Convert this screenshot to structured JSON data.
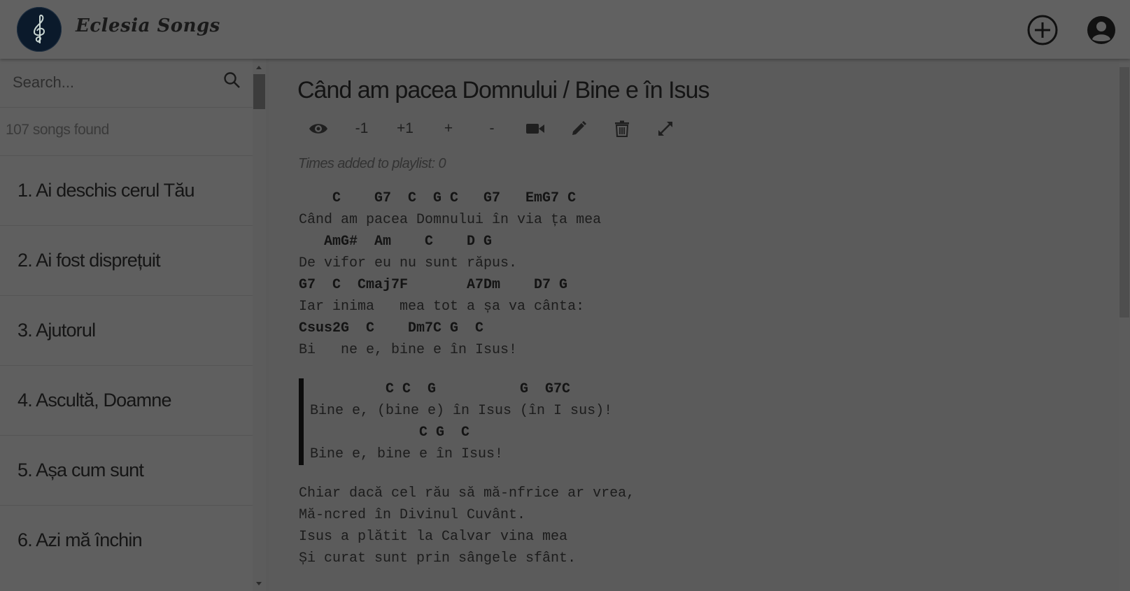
{
  "header": {
    "brand": "Eclesia Songs",
    "logo_icon": "treble-clef-icon",
    "add_icon": "plus-circle-icon",
    "user_icon": "user-account-icon"
  },
  "sidebar": {
    "search_placeholder": "Search...",
    "songs_found": "107 songs found",
    "songs": [
      {
        "label": "1. Ai deschis cerul Tău"
      },
      {
        "label": "2. Ai fost disprețuit"
      },
      {
        "label": "3. Ajutorul"
      },
      {
        "label": "4. Ascultă, Doamne"
      },
      {
        "label": "5. Așa cum sunt"
      },
      {
        "label": "6. Azi mă închin"
      }
    ]
  },
  "main": {
    "title": "Când am pacea Domnului / Bine e în Isus",
    "toolbar": {
      "transpose_down": "-1",
      "transpose_up": "+1",
      "font_increase": "+",
      "font_decrease": "-"
    },
    "playlist_count": "Times added to playlist: 0",
    "lyrics": {
      "verse1": [
        "    C    G7  C  G C   G7   EmG7 C",
        "Când am pacea Domnului în via ța mea",
        "   AmG#  Am    C    D G",
        "De vifor eu nu sunt răpus.",
        "G7  C  Cmaj7F       A7Dm    D7 G",
        "Iar inima   mea tot a șa va cânta:",
        "Csus2G  C    Dm7C G  C",
        "Bi   ne e, bine e în Isus!"
      ],
      "chorus": [
        "         C C  G          G  G7C",
        "Bine e, (bine e) în Isus (în I sus)!",
        "             C G  C",
        "Bine e, bine e în Isus!"
      ],
      "verse2": [
        "Chiar dacă cel rău să mă-nfrice ar vrea,",
        "Mă-ncred în Divinul Cuvânt.",
        "Isus a plătit la Calvar vina mea",
        "Și curat sunt prin sângele sfânt."
      ]
    }
  }
}
